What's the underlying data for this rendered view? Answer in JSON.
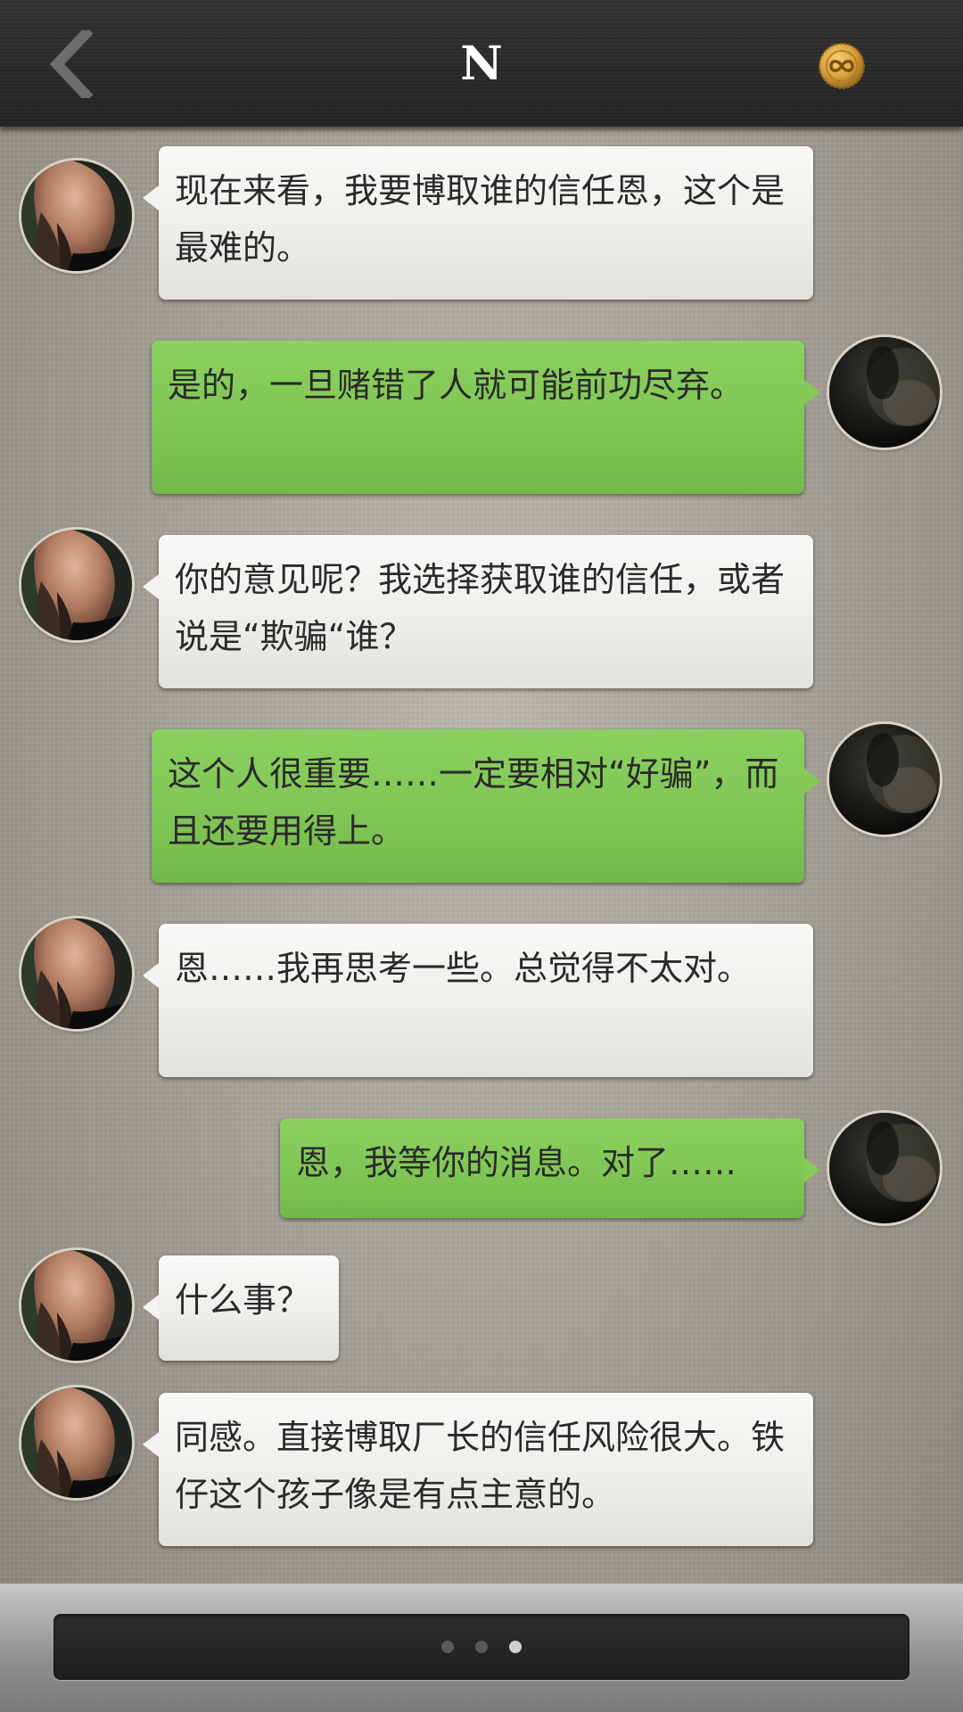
{
  "header": {
    "title": "N",
    "back_icon": "chevron-left-icon",
    "right_icon": "gold-coin-infinity-icon"
  },
  "messages": [
    {
      "side": "left",
      "avatar": "contact-avatar",
      "text": "现在来看，我要博取谁的信任恩，这个是最难的。"
    },
    {
      "side": "right",
      "avatar": "self-avatar",
      "text": "是的，一旦赌错了人就可能前功尽弃。"
    },
    {
      "side": "left",
      "avatar": "contact-avatar",
      "text": "你的意见呢？我选择获取谁的信任，或者说是“欺骗“谁？"
    },
    {
      "side": "right",
      "avatar": "self-avatar",
      "text": "这个人很重要……一定要相对“好骗”，而且还要用得上。"
    },
    {
      "side": "left",
      "avatar": "contact-avatar",
      "text": "恩……我再思考一些。总觉得不太对。"
    },
    {
      "side": "right",
      "avatar": "self-avatar",
      "text": "恩，我等你的消息。对了……"
    },
    {
      "side": "left",
      "avatar": "contact-avatar",
      "text": "什么事？"
    },
    {
      "side": "left",
      "avatar": "contact-avatar",
      "text": "同感。直接博取厂长的信任风险很大。铁仔这个孩子像是有点主意的。"
    }
  ],
  "pager": {
    "page_count": 3,
    "active_page": 3
  },
  "colors": {
    "header_bg": "#2a2a2a",
    "incoming_bubble": "#eeeeeb",
    "outgoing_bubble": "#80c655",
    "coin_gold": "#d9a23a"
  }
}
